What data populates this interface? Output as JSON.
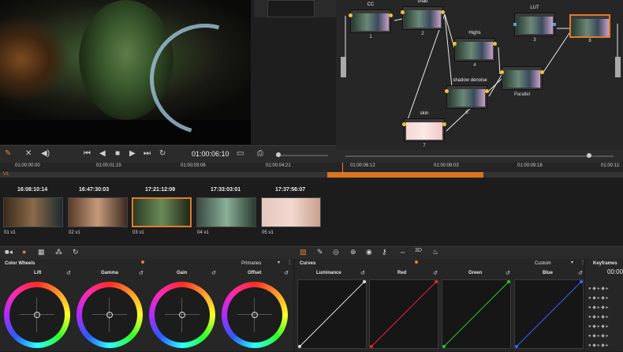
{
  "viewer": {
    "timecode": "01:00:06:10"
  },
  "nodes": [
    {
      "label": "CC",
      "num": "1"
    },
    {
      "label": "shad",
      "num": "2"
    },
    {
      "label": "LUT",
      "num": "3"
    },
    {
      "label": "Highs",
      "num": "4"
    },
    {
      "label": "shadow denoise",
      "num": "6"
    },
    {
      "label": "Parallel",
      "num": ""
    },
    {
      "label": "skin",
      "num": "7"
    },
    {
      "label": "",
      "num": "8"
    }
  ],
  "ruler": {
    "track": "V1",
    "ticks": [
      "01:00:00:00",
      "01:00:01:15",
      "01:00:03:06",
      "01:00:04:21",
      "01:00:06:12",
      "01:00:08:03",
      "01:00:09:18",
      "01:00:11:"
    ]
  },
  "clips": [
    {
      "time": "16:08:10:14",
      "name": "01",
      "track": "v1"
    },
    {
      "time": "16:47:30:03",
      "name": "02",
      "track": "v1"
    },
    {
      "time": "17:21:12:09",
      "name": "03",
      "track": "v1"
    },
    {
      "time": "17:33:03:01",
      "name": "04",
      "track": "v1"
    },
    {
      "time": "17:37:56:07",
      "name": "05",
      "track": "v1"
    }
  ],
  "toolbar": {
    "3d": "3D"
  },
  "color_wheels": {
    "title": "Color Wheels",
    "mode": "Primaries",
    "wheels": [
      "Lift",
      "Gamma",
      "Gain",
      "Offset"
    ]
  },
  "curves": {
    "title": "Curves",
    "mode": "Custom",
    "channels": [
      "Luminance",
      "Red",
      "Green",
      "Blue"
    ]
  },
  "keyframes": {
    "title": "Keyframes",
    "timecode": "00:00"
  },
  "colors": {
    "accent": "#e07b2a",
    "node_dot": "#f1c232"
  }
}
